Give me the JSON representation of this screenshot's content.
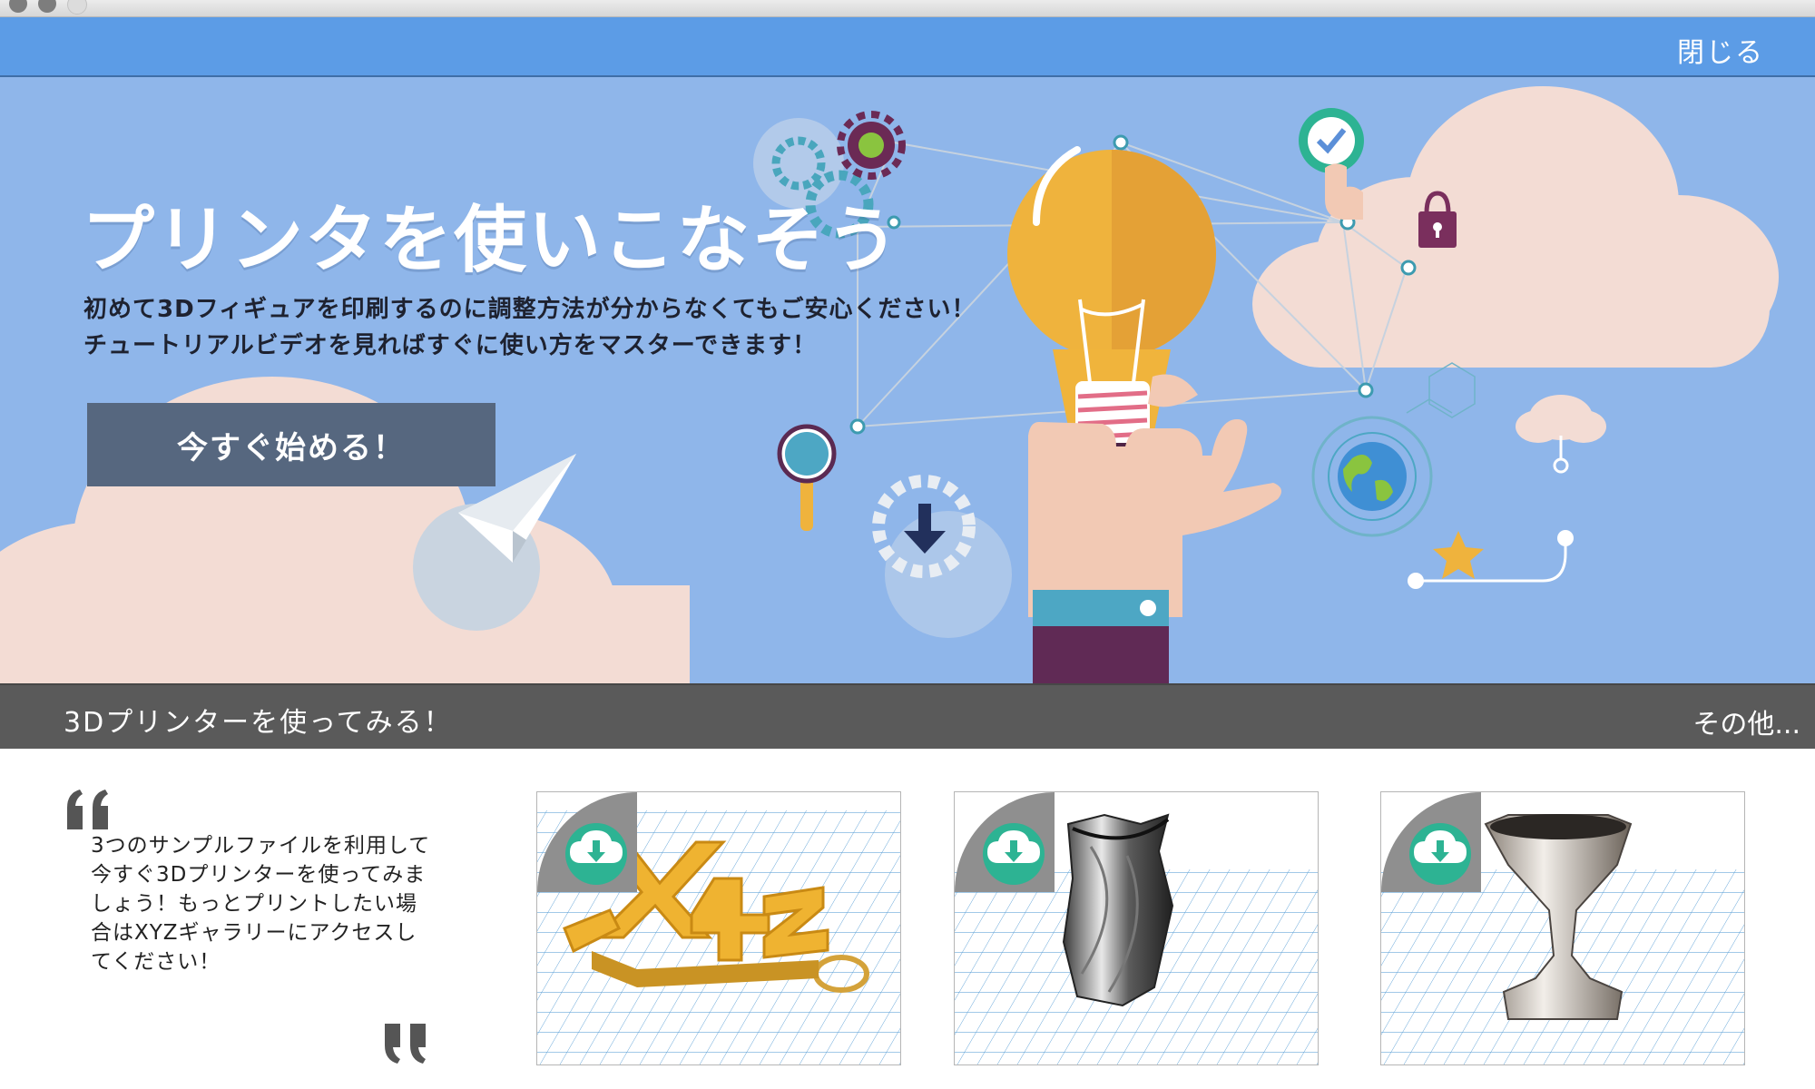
{
  "window": {
    "close_label": "閉じる"
  },
  "hero": {
    "title": "プリンタを使いこなそう",
    "subtitle_line1": "初めて3Dフィギュアを印刷するのに調整方法が分からなくてもご安心ください！",
    "subtitle_line2": "チュートリアルビデオを見ればすぐに使い方をマスターできます！",
    "cta_label": "今すぐ始める！"
  },
  "section": {
    "title": "3Dプリンターを使ってみる！",
    "more_label": "その他..."
  },
  "quote": {
    "text": "3つのサンプルファイルを利用して今すぐ3Dプリンターを使ってみましょう！もっとプリントしたい場合はXYZギャラリーにアクセスしてください！"
  },
  "samples": [
    {
      "icon": "xyz-keychain-model",
      "download_icon": "cloud-download-icon"
    },
    {
      "icon": "twisted-vase-model",
      "download_icon": "cloud-download-icon"
    },
    {
      "icon": "goblet-model",
      "download_icon": "cloud-download-icon"
    }
  ],
  "colors": {
    "top_bar": "#5c9ce6",
    "hero_bg": "#8fb6ea",
    "cta_bg": "#56677f",
    "section_bar": "#5a5a5a",
    "download_badge": "#2db393",
    "accent_gold": "#f2b63b"
  }
}
